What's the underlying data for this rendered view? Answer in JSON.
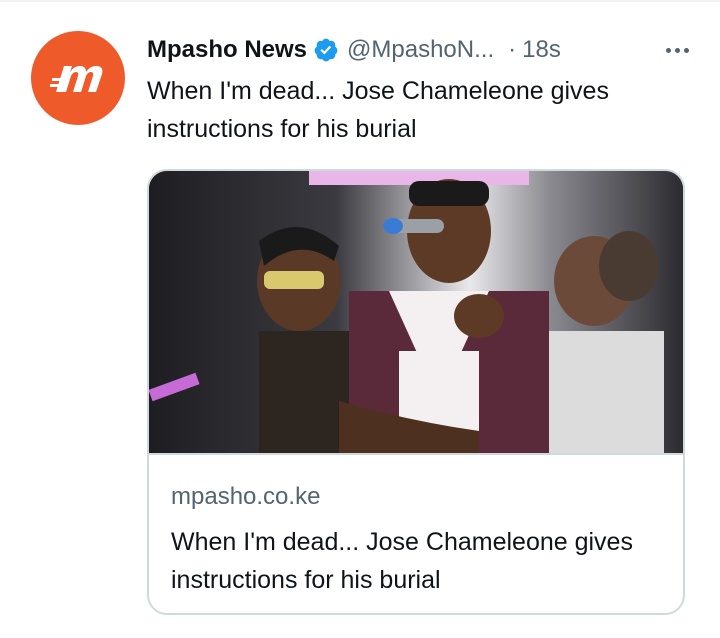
{
  "tweet": {
    "author": {
      "display_name": "Mpasho News",
      "handle": "@MpashoN...",
      "verified": true,
      "avatar_text": "m",
      "avatar_color": "#ef5a2b"
    },
    "separator": "·",
    "timestamp": "18s",
    "text": "When I'm dead... Jose Chameleone gives instructions for his burial",
    "more_icon": "more-horizontal-icon"
  },
  "card": {
    "domain": "mpasho.co.ke",
    "title": "When I'm dead... Jose Chameleone gives instructions for his burial",
    "image_description_icon": "article-photo"
  },
  "colors": {
    "text_primary": "#0f1419",
    "text_secondary": "#536471",
    "verified_blue": "#1d9bf0",
    "border": "#cfd9de"
  }
}
